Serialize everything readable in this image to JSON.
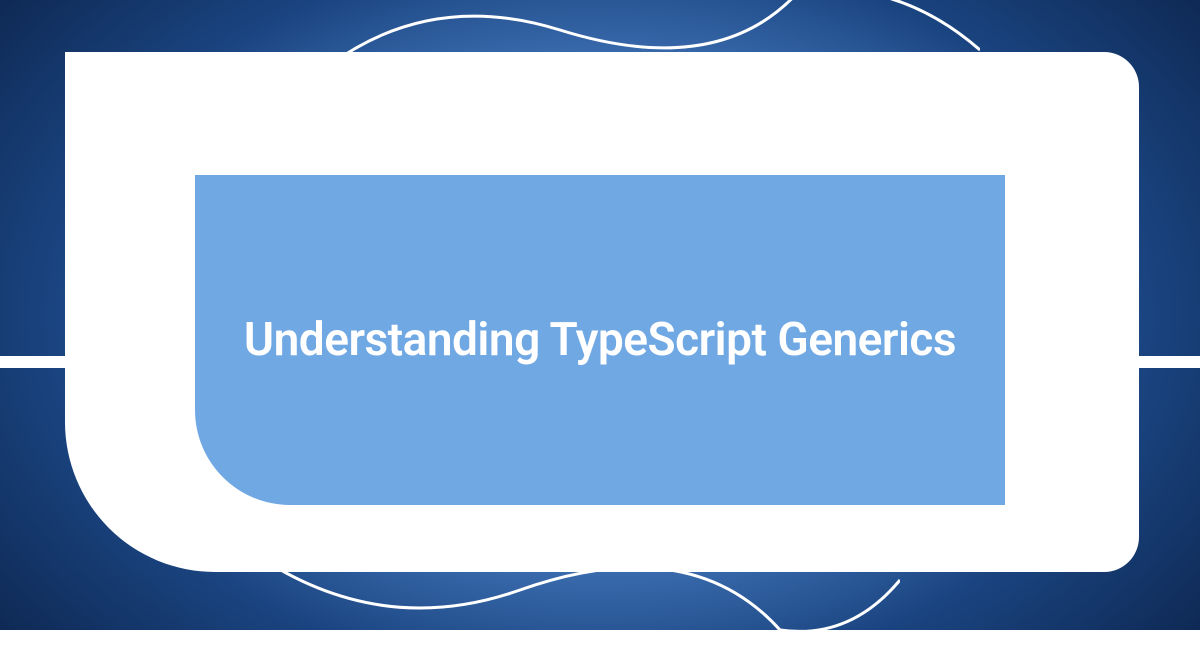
{
  "title": "Understanding TypeScript Generics",
  "colors": {
    "background_center": "#71a9e8",
    "background_edge": "#0a1f44",
    "inner_card": "#70a8e4",
    "outer_card": "#ffffff",
    "text": "#ffffff"
  }
}
